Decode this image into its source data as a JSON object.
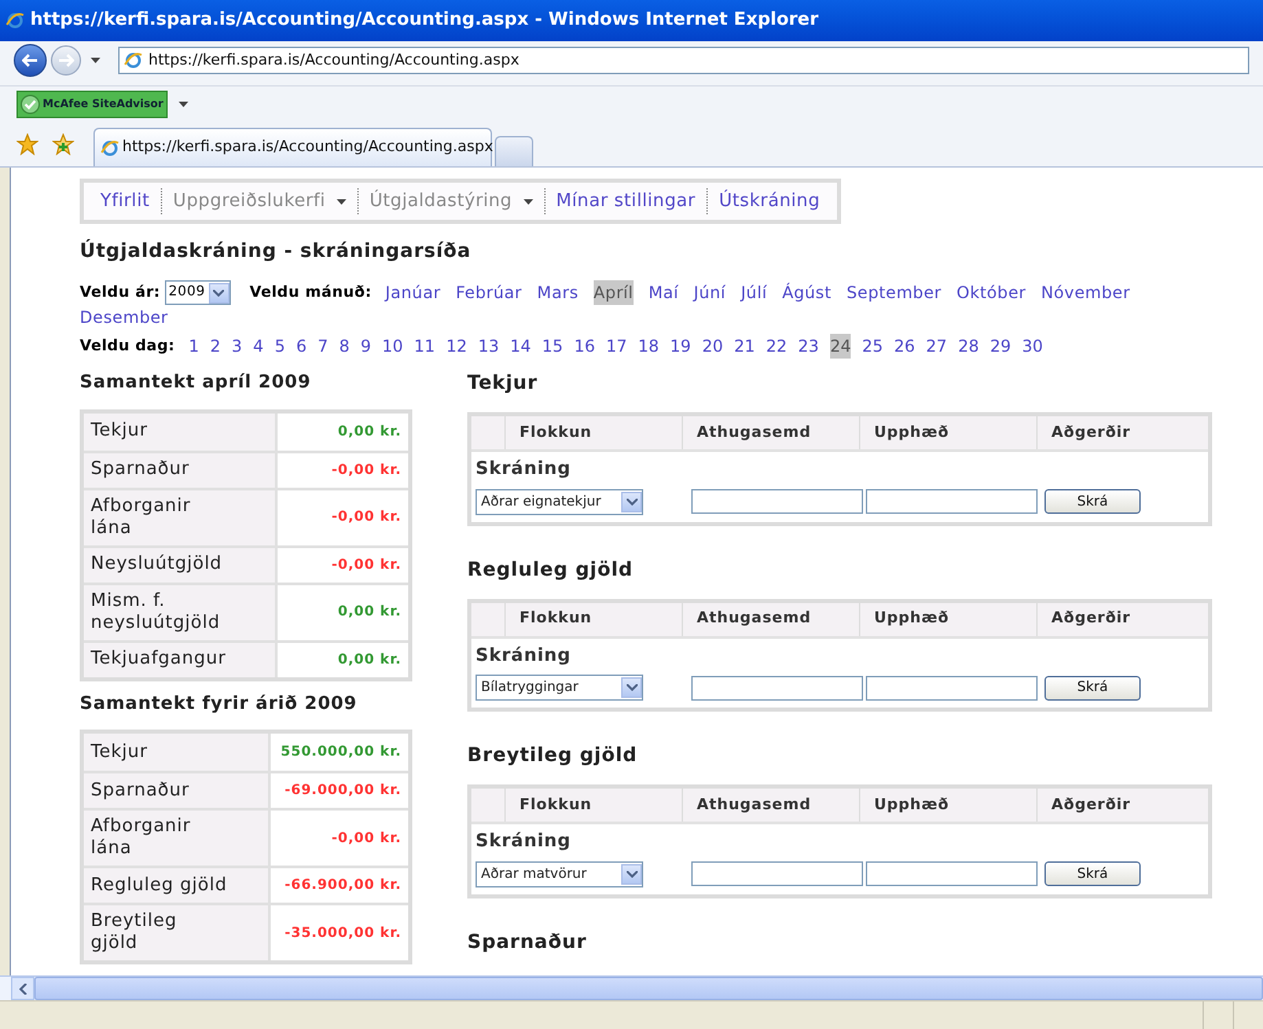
{
  "window": {
    "title": "https://kerfi.spara.is/Accounting/Accounting.aspx - Windows Internet Explorer"
  },
  "address_bar": {
    "url": "https://kerfi.spara.is/Accounting/Accounting.aspx"
  },
  "toolbar": {
    "siteadvisor": "McAfee SiteAdvisor"
  },
  "tabs": [
    {
      "label": "https://kerfi.spara.is/Accounting/Accounting.aspx",
      "selected": true
    }
  ],
  "nav": [
    {
      "label": "Yfirlit",
      "dropdown": false,
      "disabled": false
    },
    {
      "label": "Uppgreiðslukerfi",
      "dropdown": true,
      "disabled": true
    },
    {
      "label": "Útgjaldastýring",
      "dropdown": true,
      "disabled": true
    },
    {
      "label": "Mínar stillingar",
      "dropdown": false,
      "disabled": false
    },
    {
      "label": "Útskráning",
      "dropdown": false,
      "disabled": false
    }
  ],
  "page_title": "Útgjaldaskráning - skráningarsíða",
  "year": {
    "label": "Veldu ár:",
    "value": "2009"
  },
  "months": {
    "label": "Veldu mánuð:",
    "items": [
      {
        "label": "Janúar",
        "selected": false
      },
      {
        "label": "Febrúar",
        "selected": false
      },
      {
        "label": "Mars",
        "selected": false
      },
      {
        "label": "Apríl",
        "selected": true
      },
      {
        "label": "Maí",
        "selected": false
      },
      {
        "label": "Júní",
        "selected": false
      },
      {
        "label": "Júlí",
        "selected": false
      },
      {
        "label": "Ágúst",
        "selected": false
      },
      {
        "label": "September",
        "selected": false
      },
      {
        "label": "Október",
        "selected": false
      },
      {
        "label": "Nóvember",
        "selected": false
      },
      {
        "label": "Desember",
        "selected": false
      }
    ]
  },
  "days": {
    "label": "Veldu dag:",
    "items": [
      {
        "label": "1",
        "selected": false
      },
      {
        "label": "2",
        "selected": false
      },
      {
        "label": "3",
        "selected": false
      },
      {
        "label": "4",
        "selected": false
      },
      {
        "label": "5",
        "selected": false
      },
      {
        "label": "6",
        "selected": false
      },
      {
        "label": "7",
        "selected": false
      },
      {
        "label": "8",
        "selected": false
      },
      {
        "label": "9",
        "selected": false
      },
      {
        "label": "10",
        "selected": false
      },
      {
        "label": "11",
        "selected": false
      },
      {
        "label": "12",
        "selected": false
      },
      {
        "label": "13",
        "selected": false
      },
      {
        "label": "14",
        "selected": false
      },
      {
        "label": "15",
        "selected": false
      },
      {
        "label": "16",
        "selected": false
      },
      {
        "label": "17",
        "selected": false
      },
      {
        "label": "18",
        "selected": false
      },
      {
        "label": "19",
        "selected": false
      },
      {
        "label": "20",
        "selected": false
      },
      {
        "label": "21",
        "selected": false
      },
      {
        "label": "22",
        "selected": false
      },
      {
        "label": "23",
        "selected": false
      },
      {
        "label": "24",
        "selected": true
      },
      {
        "label": "25",
        "selected": false
      },
      {
        "label": "26",
        "selected": false
      },
      {
        "label": "27",
        "selected": false
      },
      {
        "label": "28",
        "selected": false
      },
      {
        "label": "29",
        "selected": false
      },
      {
        "label": "30",
        "selected": false
      }
    ]
  },
  "summaries": [
    {
      "title": "Samantekt apríl 2009",
      "rows": [
        {
          "label": "Tekjur",
          "value": "0,00 kr.",
          "color": "#339933"
        },
        {
          "label": "Sparnaður",
          "value": "-0,00 kr.",
          "color": "#ff3333"
        },
        {
          "label": "Afborganir lána",
          "value": "-0,00 kr.",
          "color": "#ff3333"
        },
        {
          "label": "Neysluútgjöld",
          "value": "-0,00 kr.",
          "color": "#ff3333"
        },
        {
          "label": "Mism. f. neysluútgjöld",
          "value": "0,00 kr.",
          "color": "#339933"
        },
        {
          "label": "Tekjuafgangur",
          "value": "0,00 kr.",
          "color": "#339933"
        }
      ]
    },
    {
      "title": "Samantekt fyrir árið 2009",
      "rows": [
        {
          "label": "Tekjur",
          "value": "550.000,00 kr.",
          "color": "#339933"
        },
        {
          "label": "Sparnaður",
          "value": "-69.000,00 kr.",
          "color": "#ff3333"
        },
        {
          "label": "Afborganir lána",
          "value": "-0,00 kr.",
          "color": "#ff3333"
        },
        {
          "label": "Regluleg gjöld",
          "value": "-66.900,00 kr.",
          "color": "#ff3333"
        },
        {
          "label": "Breytileg gjöld",
          "value": "-35.000,00 kr.",
          "color": "#ff3333"
        }
      ]
    }
  ],
  "sections": [
    {
      "title": "Tekjur",
      "columns": [
        "Flokkun",
        "Athugasemd",
        "Upphæð",
        "Aðgerðir"
      ],
      "entry_label": "Skráning",
      "category": "Aðrar eignatekjur",
      "button": "Skrá"
    },
    {
      "title": "Regluleg gjöld",
      "columns": [
        "Flokkun",
        "Athugasemd",
        "Upphæð",
        "Aðgerðir"
      ],
      "entry_label": "Skráning",
      "category": "Bílatryggingar",
      "button": "Skrá"
    },
    {
      "title": "Breytileg gjöld",
      "columns": [
        "Flokkun",
        "Athugasemd",
        "Upphæð",
        "Aðgerðir"
      ],
      "entry_label": "Skráning",
      "category": "Aðrar matvörur",
      "button": "Skrá"
    },
    {
      "title": "Sparnaður"
    }
  ]
}
